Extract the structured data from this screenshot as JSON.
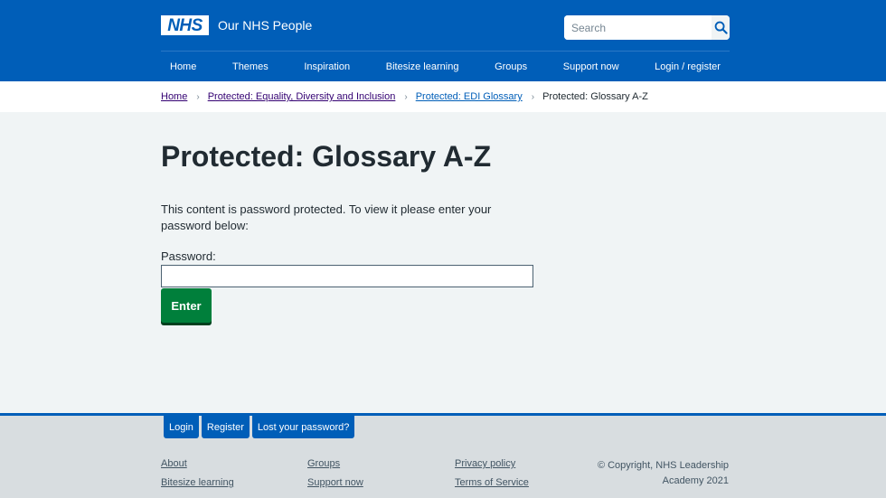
{
  "header": {
    "logo_text": "NHS",
    "site_title": "Our NHS People",
    "search_placeholder": "Search"
  },
  "nav": {
    "items": [
      {
        "label": "Home"
      },
      {
        "label": "Themes"
      },
      {
        "label": "Inspiration"
      },
      {
        "label": "Bitesize learning"
      },
      {
        "label": "Groups"
      },
      {
        "label": "Support now"
      },
      {
        "label": "Login / register"
      }
    ]
  },
  "breadcrumb": {
    "items": [
      {
        "label": "Home"
      },
      {
        "label": "Protected: Equality, Diversity and Inclusion"
      },
      {
        "label": "Protected: EDI Glossary"
      }
    ],
    "current": "Protected: Glossary A-Z",
    "separator": "›"
  },
  "main": {
    "title": "Protected: Glossary A-Z",
    "intro": "This content is password protected. To view it please enter your password below:",
    "password_label": "Password:",
    "password_value": "",
    "enter_label": "Enter"
  },
  "footer": {
    "buttons": [
      {
        "label": "Login"
      },
      {
        "label": "Register"
      },
      {
        "label": "Lost your password?"
      }
    ],
    "links": [
      {
        "label": "About"
      },
      {
        "label": "Bitesize learning"
      },
      {
        "label": "Groups"
      },
      {
        "label": "Support now"
      },
      {
        "label": "Privacy policy"
      },
      {
        "label": "Terms of Service"
      }
    ],
    "copyright": "© Copyright, NHS Leadership Academy 2021"
  },
  "colors": {
    "brand_blue": "#005eb8",
    "button_green": "#007f3b",
    "page_bg": "#f0f4f5",
    "footer_bg": "#d8dde0"
  }
}
